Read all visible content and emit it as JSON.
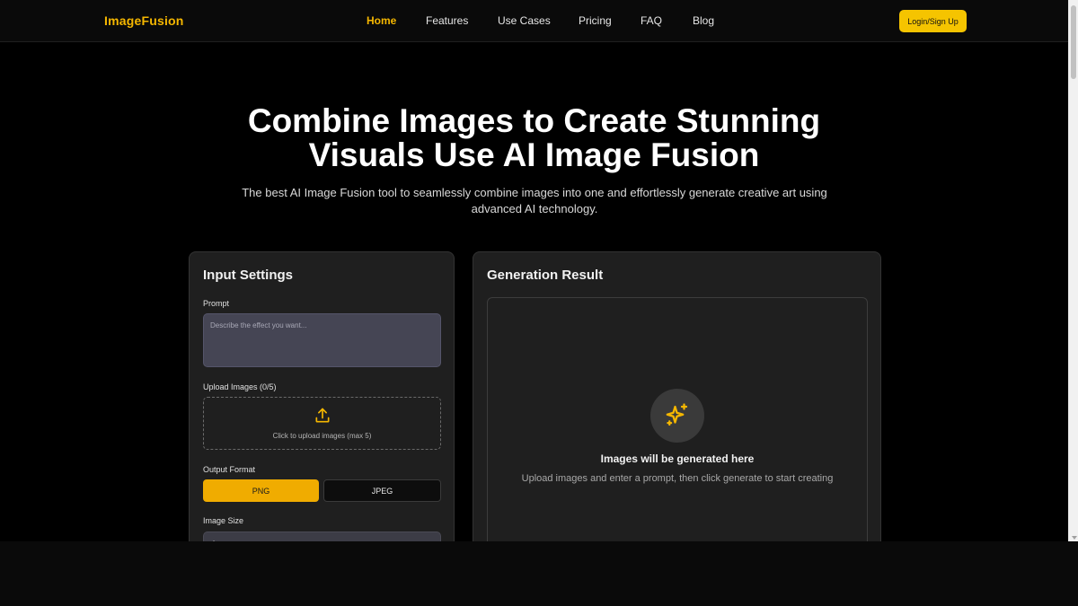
{
  "header": {
    "logo": "ImageFusion",
    "nav": [
      "Home",
      "Features",
      "Use Cases",
      "Pricing",
      "FAQ",
      "Blog"
    ],
    "active_nav": "Home",
    "login_label": "Login/Sign Up"
  },
  "hero": {
    "title_line1": "Combine Images to Create Stunning",
    "title_line2": "Visuals Use AI Image Fusion",
    "subtitle": "The best AI Image Fusion tool to seamlessly combine images into one and effortlessly generate creative art using advanced AI technology."
  },
  "input_settings": {
    "title": "Input Settings",
    "prompt_label": "Prompt",
    "prompt_placeholder": "Describe the effect you want...",
    "upload_label": "Upload Images (0/5)",
    "upload_text": "Click to upload images (max 5)",
    "output_format_label": "Output Format",
    "formats": [
      "PNG",
      "JPEG"
    ],
    "selected_format": "PNG",
    "image_size_label": "Image Size",
    "image_size_value": "Auto"
  },
  "result": {
    "title": "Generation Result",
    "placeholder_title": "Images will be generated here",
    "placeholder_sub": "Upload images and enter a prompt, then click generate to start creating"
  },
  "colors": {
    "accent": "#f5b700",
    "background": "#000000",
    "panel": "#1f1f1f"
  },
  "icons": [
    "upload-icon",
    "sparkles-icon"
  ]
}
